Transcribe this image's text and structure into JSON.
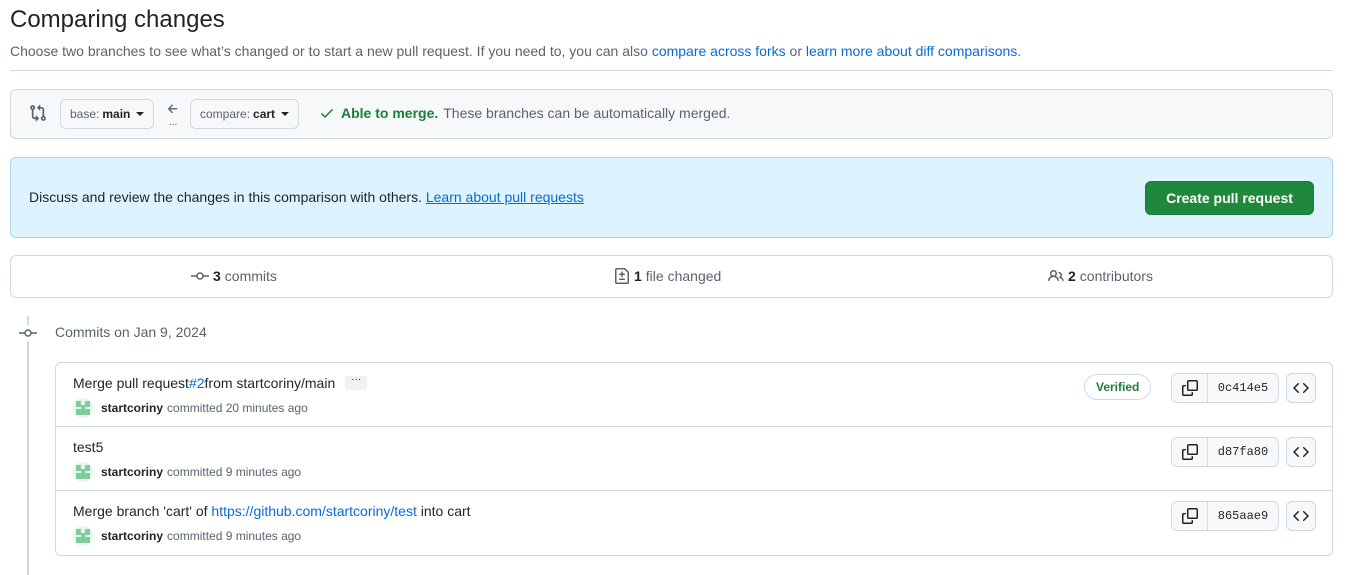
{
  "header": {
    "title": "Comparing changes",
    "subtitle_prefix": "Choose two branches to see what’s changed or to start a new pull request. If you need to, you can also ",
    "link_forks": "compare across forks",
    "subtitle_or": " or ",
    "link_learn": "learn more about diff comparisons",
    "subtitle_end": "."
  },
  "range": {
    "base_prefix": "base:",
    "base_branch": "main",
    "compare_prefix": "compare:",
    "compare_branch": "cart",
    "swap_ellipsis": "...",
    "merge_ok": "Able to merge.",
    "merge_desc": "These branches can be automatically merged."
  },
  "flash": {
    "text": "Discuss and review the changes in this comparison with others. ",
    "link": "Learn about pull requests",
    "button": "Create pull request"
  },
  "summary": {
    "commits_count": "3",
    "commits_label": "commits",
    "files_count": "1",
    "files_label": "file changed",
    "contributors_count": "2",
    "contributors_label": "contributors"
  },
  "timeline": {
    "date_heading": "Commits on Jan 9, 2024"
  },
  "commits": [
    {
      "title_prefix": "Merge pull request ",
      "title_link": "#2",
      "title_suffix": " from startcoriny/main",
      "expander": "···",
      "author": "startcoriny",
      "action": "committed 20 minutes ago",
      "verified": "Verified",
      "sha": "0c414e5"
    },
    {
      "title_prefix": "test5",
      "title_link": "",
      "title_suffix": "",
      "author": "startcoriny",
      "action": "committed 9 minutes ago",
      "sha": "d87fa80"
    },
    {
      "title_prefix": "Merge branch 'cart' of ",
      "title_link": "https://github.com/startcoriny/test",
      "title_suffix": " into cart",
      "author": "startcoriny",
      "action": "committed 9 minutes ago",
      "sha": "865aae9"
    }
  ],
  "colors": {
    "accent": "#0969da",
    "success": "#1a7f37",
    "primary_button": "#1f883d",
    "flash_bg": "#ddf4ff"
  }
}
